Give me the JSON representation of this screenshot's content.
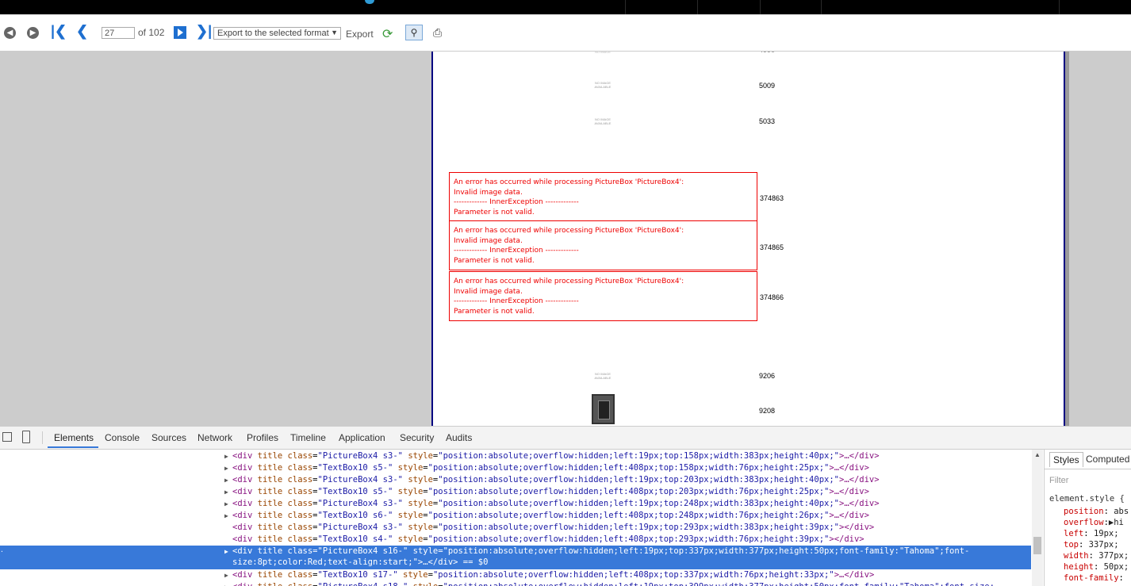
{
  "toolbar": {
    "current_page": "27",
    "page_total": "of 102",
    "export_format": "Export to the selected format",
    "export_label": "Export"
  },
  "report": {
    "rows_top": [
      {
        "image": "NO IMAGE AVAILABLE",
        "number": "5009"
      },
      {
        "image": "NO IMAGE AVAILABLE",
        "number": "5033"
      }
    ],
    "errors": [
      {
        "lines": [
          "An error has occurred while processing PictureBox 'PictureBox4':",
          "Invalid image data.",
          "------------- InnerException -------------",
          "Parameter is not valid."
        ],
        "number": "374863"
      },
      {
        "lines": [
          "An error has occurred while processing PictureBox 'PictureBox4':",
          "Invalid image data.",
          "------------- InnerException -------------",
          "Parameter is not valid."
        ],
        "number": "374865"
      },
      {
        "lines": [
          "An error has occurred while processing PictureBox 'PictureBox4':",
          "Invalid image data.",
          "------------- InnerException -------------",
          "Parameter is not valid."
        ],
        "number": "374866"
      }
    ],
    "rows_bottom": [
      {
        "image": "NO IMAGE AVAILABLE",
        "number": "9206"
      },
      {
        "number": "9208"
      }
    ]
  },
  "devtools": {
    "tabs": [
      "Elements",
      "Console",
      "Sources",
      "Network",
      "Profiles",
      "Timeline",
      "Application",
      "Security",
      "Audits"
    ],
    "active_tab": "Elements",
    "dom_rows": [
      {
        "cls": "PictureBox4 s3-",
        "style": "position:absolute;overflow:hidden;left:19px;top:158px;width:383px;height:40px;",
        "end": "…</div>"
      },
      {
        "cls": "TextBox10 s5-",
        "style": "position:absolute;overflow:hidden;left:408px;top:158px;width:76px;height:25px;",
        "end": "…</div>"
      },
      {
        "cls": "PictureBox4 s3-",
        "style": "position:absolute;overflow:hidden;left:19px;top:203px;width:383px;height:40px;",
        "end": "…</div>"
      },
      {
        "cls": "TextBox10 s5-",
        "style": "position:absolute;overflow:hidden;left:408px;top:203px;width:76px;height:25px;",
        "end": "…</div>"
      },
      {
        "cls": "PictureBox4 s3-",
        "style": "position:absolute;overflow:hidden;left:19px;top:248px;width:383px;height:40px;",
        "end": "…</div>"
      },
      {
        "cls": "TextBox10 s6-",
        "style": "position:absolute;overflow:hidden;left:408px;top:248px;width:76px;height:26px;",
        "end": "…</div>"
      },
      {
        "cls": "PictureBox4 s3-",
        "style": "position:absolute;overflow:hidden;left:19px;top:293px;width:383px;height:39px;",
        "end": "</div>"
      },
      {
        "cls": "TextBox10 s4-",
        "style": "position:absolute;overflow:hidden;left:408px;top:293px;width:76px;height:39px;",
        "end": "</div>"
      }
    ],
    "selected_row": {
      "cls": "PictureBox4 s16-",
      "style": "position:absolute;overflow:hidden;left:19px;top:337px;width:377px;height:50px;font-family:\"Tahoma\";font-size:8pt;color:Red;text-align:start;",
      "end": "…</div> == $0"
    },
    "dom_rows_after": [
      {
        "cls": "TextBox10 s17-",
        "style": "position:absolute;overflow:hidden;left:408px;top:337px;width:76px;height:33px;",
        "end": "…</div>"
      },
      {
        "cls": "PictureBox4 s18-",
        "style": "position:absolute;overflow:hidden;left:19px;top:399px;width:377px;height:50px;font-family:\"Tahoma\";font-size:",
        "end": ""
      }
    ],
    "styles_tab": "Styles",
    "computed_tab": "Computed",
    "filter_placeholder": "Filter",
    "element_style": "element.style {",
    "style_props": [
      {
        "name": "position",
        "value": "abs"
      },
      {
        "name": "overflow",
        "value": "▶hi"
      },
      {
        "name": "left",
        "value": "19px;"
      },
      {
        "name": "top",
        "value": "337px;"
      },
      {
        "name": "width",
        "value": "377px;"
      },
      {
        "name": "height",
        "value": "50px;"
      },
      {
        "name": "font-family",
        "value": ""
      }
    ]
  },
  "colors": {
    "error": "#ee0000",
    "page_border": "#000080",
    "selection": "#3879d9"
  }
}
